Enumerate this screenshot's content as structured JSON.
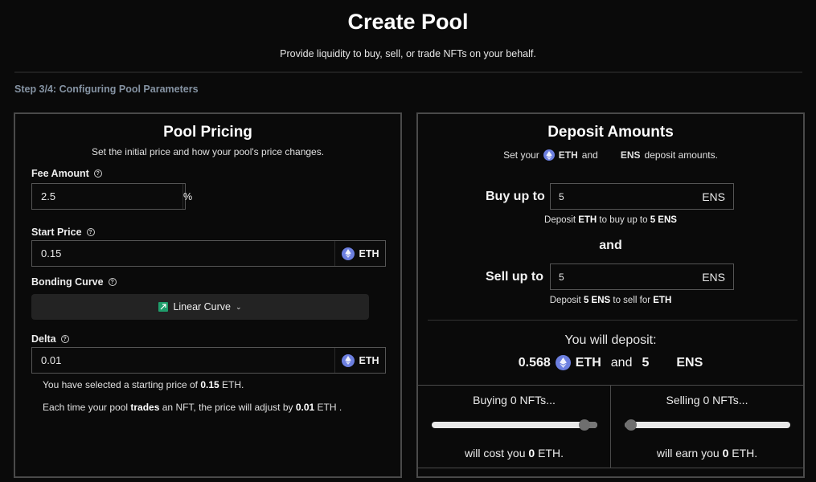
{
  "header": {
    "title": "Create Pool",
    "subtitle": "Provide liquidity to buy, sell, or trade NFTs on your behalf.",
    "step": "Step 3/4: Configuring Pool Parameters"
  },
  "pricing": {
    "title": "Pool Pricing",
    "subtitle": "Set the initial price and how your pool's price changes.",
    "fee": {
      "label": "Fee Amount",
      "value": "2.5",
      "unit": "%"
    },
    "start_price": {
      "label": "Start Price",
      "value": "0.15",
      "unit": "ETH"
    },
    "bonding_curve": {
      "label": "Bonding Curve",
      "selected": "Linear Curve"
    },
    "delta": {
      "label": "Delta",
      "value": "0.01",
      "unit": "ETH"
    },
    "info": {
      "line1_pre": "You have selected a starting price of ",
      "line1_value": "0.15",
      "line1_post": " ETH.",
      "line2_pre": "Each time your pool ",
      "line2_bold": "trades",
      "line2_mid": " an NFT, the price will adjust by ",
      "line2_value": "0.01",
      "line2_post": " ETH ."
    }
  },
  "deposit": {
    "title": "Deposit Amounts",
    "subtitle_pre": "Set your",
    "subtitle_eth": "ETH",
    "subtitle_and": "and",
    "subtitle_ens": "ENS",
    "subtitle_post": "deposit amounts.",
    "buy": {
      "label": "Buy up to",
      "value": "5",
      "unit": "ENS"
    },
    "buy_hint": {
      "pre": "Deposit ",
      "eth": "ETH",
      "mid": " to buy up to ",
      "amount": "5 ENS"
    },
    "and_label": "and",
    "sell": {
      "label": "Sell up to",
      "value": "5",
      "unit": "ENS"
    },
    "sell_hint": {
      "pre": "Deposit ",
      "amount": "5 ENS",
      "mid": " to sell for ",
      "eth": "ETH"
    },
    "total_label": "You will deposit:",
    "total_eth": "0.568",
    "total_eth_unit": "ETH",
    "total_and": "and",
    "total_ens": "5",
    "total_ens_unit": "ENS"
  },
  "simulation": {
    "buying": {
      "title": "Buying 0 NFTs...",
      "result_pre": "will cost you ",
      "result_value": "0",
      "result_post": " ETH.",
      "slider_percent": 92
    },
    "selling": {
      "title": "Selling 0 NFTs...",
      "result_pre": "will earn you ",
      "result_value": "0",
      "result_post": " ETH.",
      "slider_percent": 4
    }
  }
}
